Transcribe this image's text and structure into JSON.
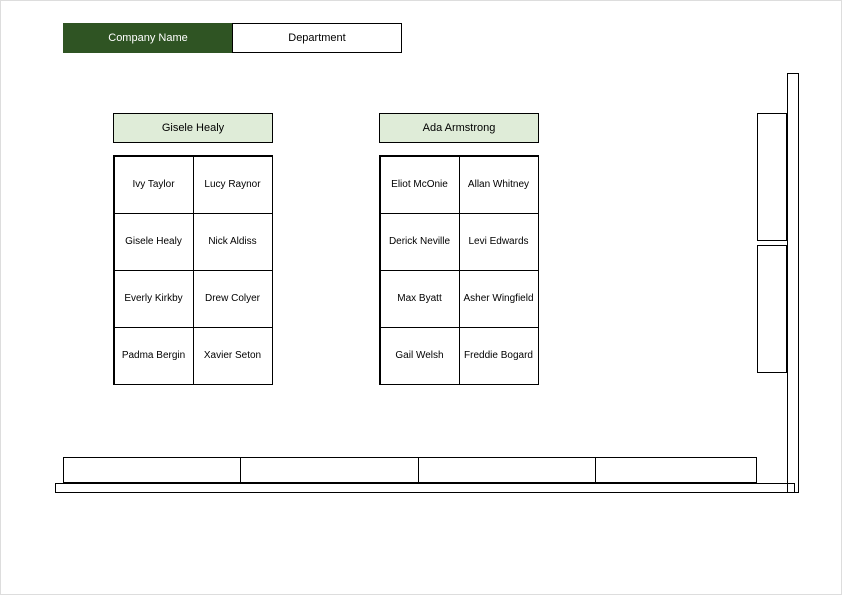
{
  "header": {
    "company": "Company Name",
    "department": "Department"
  },
  "teams": [
    {
      "leader": "Gisele Healy",
      "members": [
        [
          "Ivy Taylor",
          "Lucy Raynor"
        ],
        [
          "Gisele Healy",
          "Nick Aldiss"
        ],
        [
          "Everly Kirkby",
          "Drew Colyer"
        ],
        [
          "Padma Bergin",
          "Xavier Seton"
        ]
      ]
    },
    {
      "leader": "Ada Armstrong",
      "members": [
        [
          "Eliot McOnie",
          "Allan Whitney"
        ],
        [
          "Derick Neville",
          "Levi Edwards"
        ],
        [
          "Max Byatt",
          "Asher Wingfield"
        ],
        [
          "Gail Welsh",
          "Freddie Bogard"
        ]
      ]
    }
  ]
}
